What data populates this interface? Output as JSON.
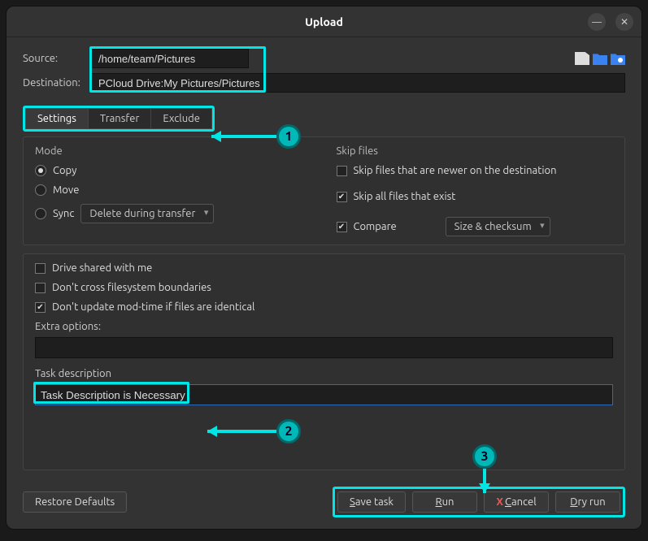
{
  "window": {
    "title": "Upload"
  },
  "paths": {
    "source_label": "Source:",
    "source_value": "/home/team/Pictures",
    "dest_label": "Destination:",
    "dest_value": "PCloud Drive:My Pictures/Pictures"
  },
  "tabs": {
    "settings": "Settings",
    "transfer": "Transfer",
    "exclude": "Exclude"
  },
  "mode": {
    "title": "Mode",
    "copy": "Copy",
    "move": "Move",
    "sync": "Sync",
    "sync_option": "Delete during transfer"
  },
  "skip": {
    "title": "Skip files",
    "newer": "Skip files that are newer on the destination",
    "exist": "Skip all files that exist",
    "compare": "Compare",
    "compare_option": "Size & checksum"
  },
  "opts": {
    "shared": "Drive shared with me",
    "nocross": "Don't cross filesystem boundaries",
    "modtime": "Don't update mod-time if files are identical",
    "extra_label": "Extra options:",
    "task_label": "Task description",
    "task_value": "Task Description is Necessary"
  },
  "footer": {
    "restore": "Restore Defaults",
    "save": "Save task",
    "run": "Run",
    "cancel": "Cancel",
    "dryrun": "Dry run"
  },
  "callouts": {
    "c1": "1",
    "c2": "2",
    "c3": "3"
  }
}
